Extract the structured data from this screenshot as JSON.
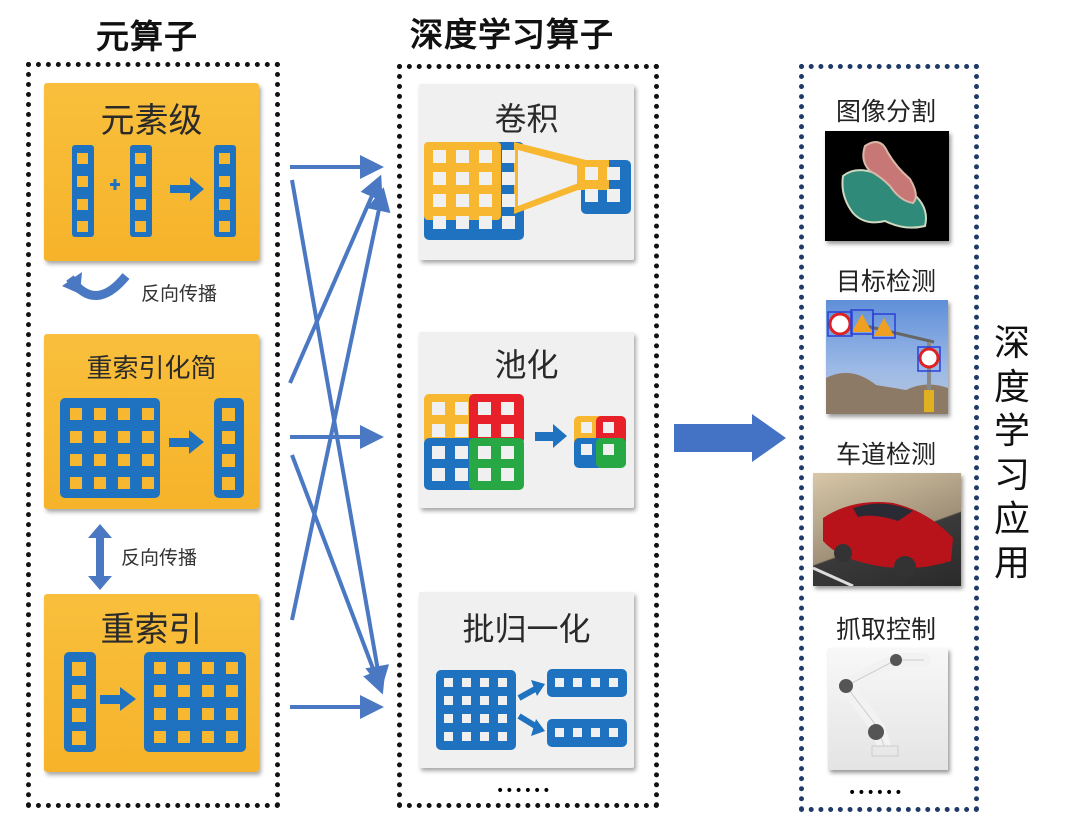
{
  "columns": {
    "meta_ops": {
      "title": "元算子",
      "cards": [
        {
          "label": "元素级"
        },
        {
          "label": "重索引化简"
        },
        {
          "label": "重索引"
        }
      ],
      "backprop_labels": [
        "反向传播",
        "反向传播"
      ]
    },
    "dl_ops": {
      "title": "深度学习算子",
      "cards": [
        {
          "label": "卷积"
        },
        {
          "label": "池化"
        },
        {
          "label": "批归一化"
        }
      ],
      "more": "••••••"
    },
    "applications": {
      "title": "深度学习应用",
      "items": [
        {
          "label": "图像分割",
          "image": "segmentation-image"
        },
        {
          "label": "目标检测",
          "image": "traffic-sign-detection-image"
        },
        {
          "label": "车道检测",
          "image": "red-car-on-road-image"
        },
        {
          "label": "抓取控制",
          "image": "robot-arm-image"
        }
      ],
      "more": "••••••"
    }
  },
  "colors": {
    "card_yellow": "#f7b731",
    "icon_blue": "#1f72c0",
    "arrow_blue": "#4a78c2",
    "pool_red": "#e8202a",
    "pool_green": "#28a745",
    "card_gray": "#f0f0f0",
    "navy_border": "#1f3a68"
  },
  "connections": [
    {
      "from": "元素级",
      "to": "卷积"
    },
    {
      "from": "元素级",
      "to": "批归一化"
    },
    {
      "from": "重索引化简",
      "to": "卷积"
    },
    {
      "from": "重索引化简",
      "to": "池化"
    },
    {
      "from": "重索引化简",
      "to": "批归一化"
    },
    {
      "from": "重索引",
      "to": "卷积"
    },
    {
      "from": "重索引",
      "to": "批归一化"
    },
    {
      "from": "元素级",
      "to": "池化"
    }
  ]
}
